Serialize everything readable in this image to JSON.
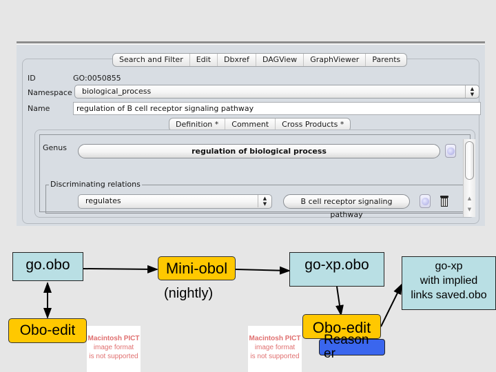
{
  "app": {
    "main_tabs": [
      "Search and Filter",
      "Edit",
      "Dbxref",
      "DAGView",
      "GraphViewer",
      "Parents"
    ],
    "fields": {
      "id_label": "ID",
      "id_value": "GO:0050855",
      "namespace_label": "Namespace",
      "namespace_value": "biological_process",
      "name_label": "Name",
      "name_value": "regulation of B cell receptor signaling pathway"
    },
    "sub_tabs": [
      "Definition *",
      "Comment",
      "Cross Products *"
    ],
    "cross_products": {
      "genus_label": "Genus",
      "genus_value": "regulation of biological process",
      "discriminating_label": "Discriminating relations",
      "relation_value": "regulates",
      "differentia_value": "B cell receptor signaling pathway"
    }
  },
  "diagram": {
    "nodes": {
      "go_obo": "go.obo",
      "mini_obol": "Mini-obol",
      "mini_obol_caption": "(nightly)",
      "go_xp_obo": "go-xp.obo",
      "go_xp_implied_line1": "go-xp",
      "go_xp_implied_line2": "with implied",
      "go_xp_implied_line3": "links saved.obo",
      "obo_edit_left": "Obo-edit",
      "obo_edit_right": "Obo-edit",
      "reasoner_line1": "Reason",
      "reasoner_line2": "er"
    },
    "pict_placeholder": {
      "line1": "Macintosh PICT",
      "line2": "image format",
      "line3": "is not supported"
    },
    "colors": {
      "document": "#b9dfe4",
      "process": "#ffc800",
      "reasoner": "#3a66ee",
      "pict_text": "#e07070"
    }
  }
}
